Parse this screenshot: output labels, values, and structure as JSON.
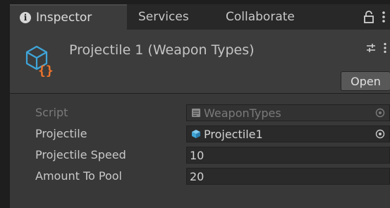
{
  "tabs": [
    {
      "label": "Inspector",
      "icon": "info-icon"
    },
    {
      "label": "Services"
    },
    {
      "label": "Collaborate"
    }
  ],
  "tab_icons": [
    "lock-icon",
    "kebab-menu-icon"
  ],
  "header": {
    "title": "Projectile 1 (Weapon Types)",
    "icon": "scriptable-object-icon",
    "open_label": "Open",
    "icons": [
      "preset-sliders-icon",
      "kebab-menu-icon"
    ]
  },
  "fields": [
    {
      "label": "Script",
      "value": "WeaponTypes",
      "icon": "script-asset-icon",
      "disabled": true,
      "picker": true
    },
    {
      "label": "Projectile",
      "value": "Projectile1",
      "icon": "prefab-cube-icon",
      "disabled": false,
      "picker": true
    },
    {
      "label": "Projectile Speed",
      "value": "10",
      "disabled": false,
      "picker": false
    },
    {
      "label": "Amount To Pool",
      "value": "20",
      "disabled": false,
      "picker": false
    }
  ],
  "colors": {
    "panel": "#383838",
    "tabbar": "#282828",
    "field": "#2a2a2a",
    "accent_orange": "#f0742a",
    "accent_blue": "#3fa5d8"
  }
}
